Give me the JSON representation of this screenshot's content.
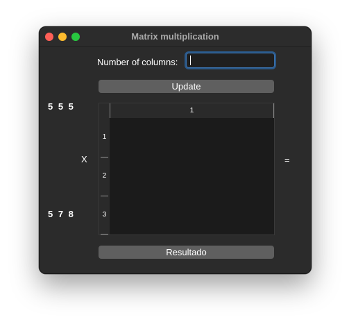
{
  "window": {
    "title": "Matrix multiplication"
  },
  "form": {
    "columns_label": "Number of columns:",
    "columns_value": "",
    "update_label": "Update",
    "result_label": "Resultado"
  },
  "left_vectors": {
    "top": "5 5 5",
    "bottom": "5 7 8"
  },
  "operators": {
    "times": "X",
    "equals": "="
  },
  "table": {
    "column_headers": [
      "1"
    ],
    "row_headers": [
      "1",
      "2",
      "3"
    ]
  }
}
